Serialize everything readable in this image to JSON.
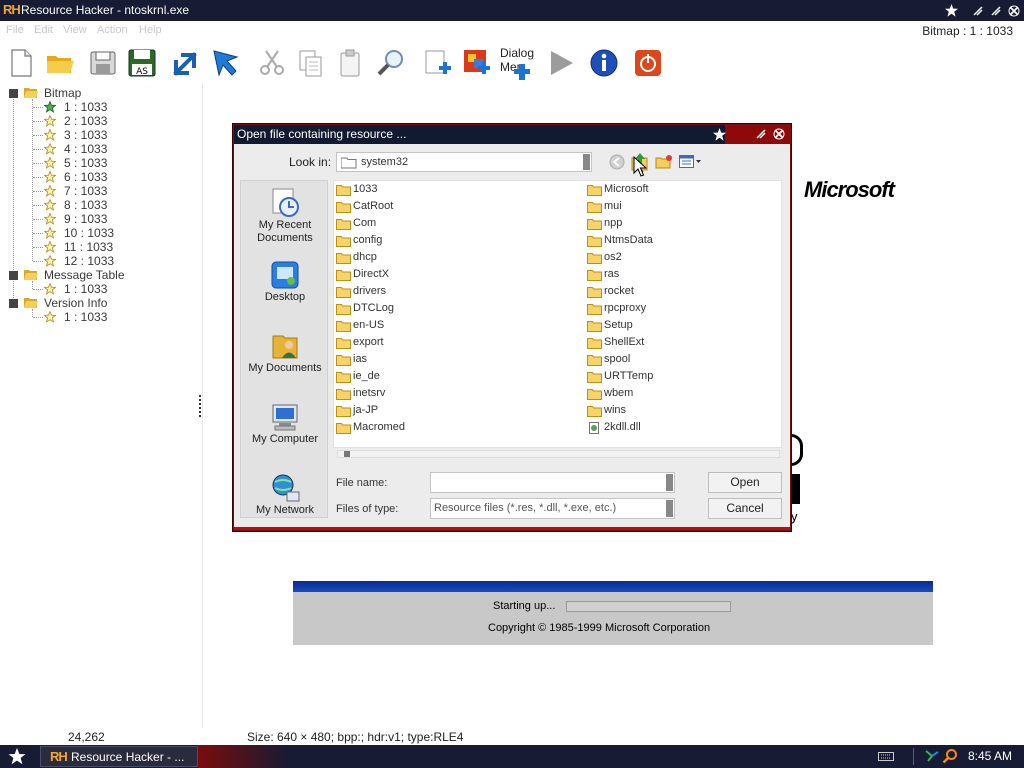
{
  "window": {
    "title": "Resource Hacker - ntoskrnl.exe",
    "logo": "RH"
  },
  "menus": [
    "File",
    "Edit",
    "View",
    "Action",
    "Help"
  ],
  "current_resource": "Bitmap : 1 : 1033",
  "toolbar": {
    "dialog_menu_label_1": "Dialog",
    "dialog_menu_label_2": "Mer"
  },
  "tree": {
    "groups": [
      {
        "label": "Bitmap",
        "children": [
          "1 : 1033",
          "2 : 1033",
          "3 : 1033",
          "4 : 1033",
          "5 : 1033",
          "6 : 1033",
          "7 : 1033",
          "8 : 1033",
          "9 : 1033",
          "10 : 1033",
          "11 : 1033",
          "12 : 1033"
        ]
      },
      {
        "label": "Message Table",
        "children": [
          "1 : 1033"
        ]
      },
      {
        "label": "Version Info",
        "children": [
          "1 : 1033"
        ]
      }
    ]
  },
  "splash": {
    "brand": "Microsoft",
    "status": "Starting up...",
    "copyright": "Copyright © 1985-1999  Microsoft Corporation",
    "progress_fraction": 0.0,
    "fragment_char": "y"
  },
  "statusbar": {
    "left": "24,262",
    "info": "Size: 640 × 480;  bpp:;  hdr:v1;  type:RLE4"
  },
  "dialog": {
    "title": "Open file containing resource ...",
    "lookin_label": "Look in:",
    "lookin_value": "system32",
    "places": [
      "My Recent Documents",
      "Desktop",
      "My Documents",
      "My Computer",
      "My Network"
    ],
    "files_col1": [
      "1033",
      "CatRoot",
      "Com",
      "config",
      "dhcp",
      "DirectX",
      "drivers",
      "DTCLog",
      "en-US",
      "export",
      "ias",
      "ie_de",
      "inetsrv",
      "ja-JP",
      "Macromed"
    ],
    "files_col2": [
      "Microsoft",
      "mui",
      "npp",
      "NtmsData",
      "os2",
      "ras",
      "rocket",
      "rpcproxy",
      "Setup",
      "ShellExt",
      "spool",
      "URTTemp",
      "wbem",
      "wins",
      "2kdll.dll"
    ],
    "filename_label": "File name:",
    "filename_value": "",
    "filetype_label": "Files of type:",
    "filetype_value": "Resource files (*.res, *.dll, *.exe, etc.)",
    "open_label": "Open",
    "cancel_label": "Cancel"
  },
  "taskbar": {
    "item_logo": "RH",
    "item_label": "Resource Hacker - ...",
    "clock": "8:45 AM"
  },
  "colors": {
    "titlebar": "#171b33",
    "accent_red": "#8e0a0a",
    "splash_blue": "#0a2c8e",
    "logo_orange": "#f4a724"
  }
}
